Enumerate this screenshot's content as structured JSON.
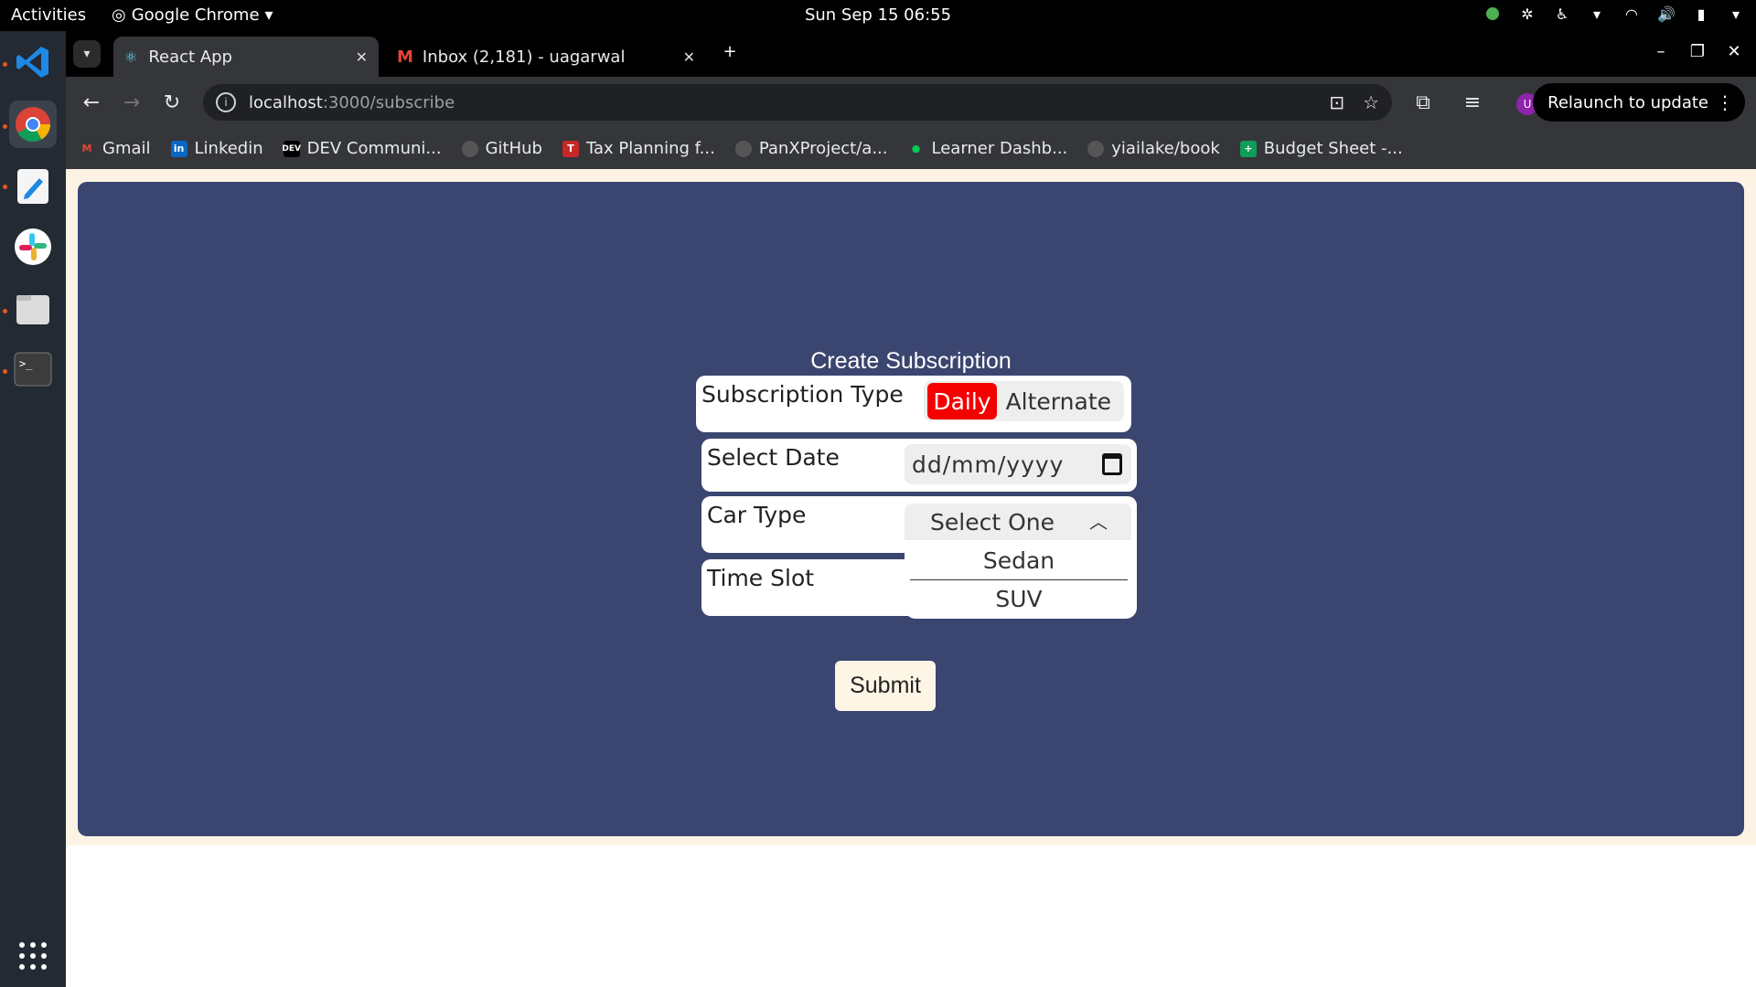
{
  "topbar": {
    "activities": "Activities",
    "app_name": "Google Chrome",
    "clock": "Sun Sep 15  06:55"
  },
  "chrome": {
    "tabs": [
      {
        "title": "React App"
      },
      {
        "title": "Inbox (2,181) - uagarwal"
      }
    ],
    "url_host": "localhost",
    "url_path": ":3000/subscribe",
    "relaunch_label": "Relaunch to update",
    "profile_initial": "U",
    "bookmarks": [
      {
        "label": "Gmail"
      },
      {
        "label": "Linkedin"
      },
      {
        "label": "DEV Communi..."
      },
      {
        "label": "GitHub"
      },
      {
        "label": "Tax Planning f..."
      },
      {
        "label": "PanXProject/a..."
      },
      {
        "label": "Learner Dashb..."
      },
      {
        "label": "yiailake/book"
      },
      {
        "label": "Budget Sheet -..."
      }
    ]
  },
  "form": {
    "title": "Create Subscription",
    "subscription_type_label": "Subscription Type",
    "options": {
      "daily": "Daily",
      "alternate": "Alternate"
    },
    "selected_type": "Daily",
    "select_date_label": "Select Date",
    "date_placeholder": "dd/mm/yyyy",
    "car_type_label": "Car Type",
    "car_select_value": "Select One",
    "car_options": [
      "Sedan",
      "SUV"
    ],
    "time_slot_label": "Time Slot",
    "submit_label": "Submit"
  },
  "colors": {
    "panel_bg": "#3a4570",
    "page_bg": "#fdf3e4",
    "active_toggle": "#f50000",
    "submit_bg": "#fdf6e6"
  }
}
